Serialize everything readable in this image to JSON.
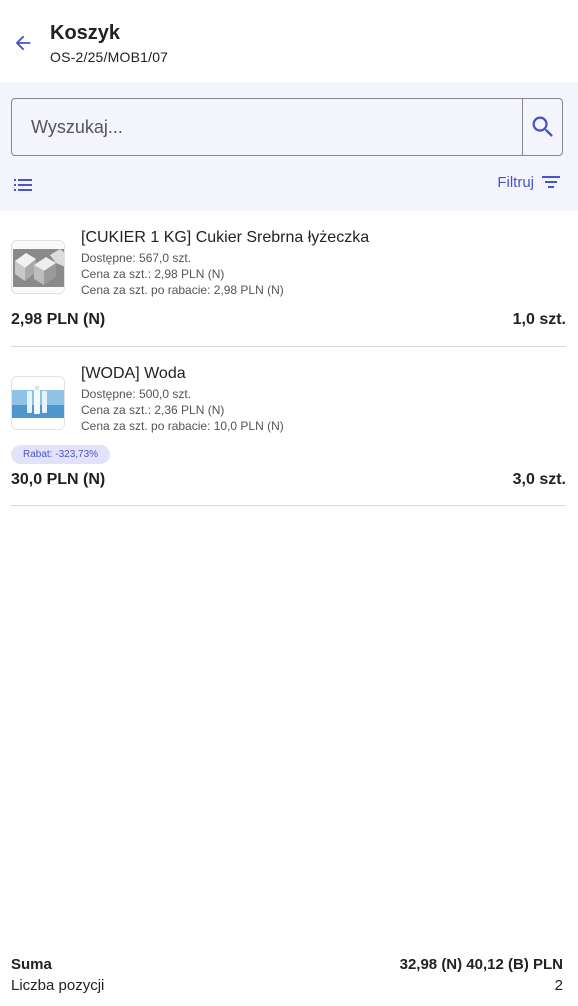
{
  "header": {
    "title": "Koszyk",
    "document_number": "OS-2/25/MOB1/07"
  },
  "search": {
    "placeholder": "Wyszukaj..."
  },
  "toolbar": {
    "filter_label": "Filtruj"
  },
  "items": [
    {
      "name": "[CUKIER 1 KG] Cukier Srebrna łyżeczka",
      "available": "Dostępne: 567,0 szt.",
      "unit_price": "Cena za szt.: 2,98 PLN (N)",
      "discounted_price": "Cena za szt. po rabacie: 2,98 PLN (N)",
      "total": "2,98 PLN (N)",
      "quantity": "1,0 szt.",
      "image_icon": "sugar-cubes-photo"
    },
    {
      "name": "[WODA] Woda",
      "available": "Dostępne: 500,0 szt.",
      "unit_price": "Cena za szt.: 2,36 PLN (N)",
      "discounted_price": "Cena za szt. po rabacie: 10,0 PLN (N)",
      "discount": "Rabat: -323,73%",
      "total": "30,0 PLN (N)",
      "quantity": "3,0 szt.",
      "image_icon": "water-bottles-photo"
    }
  ],
  "footer": {
    "sum_label": "Suma",
    "sum_value": "32,98 (N) 40,12 (B) PLN",
    "count_label": "Liczba pozycji",
    "count_value": "2"
  },
  "colors": {
    "accent": "#4a54c9",
    "toolbar_bg": "#f4f5fc",
    "badge_bg": "#e2e3f8"
  }
}
